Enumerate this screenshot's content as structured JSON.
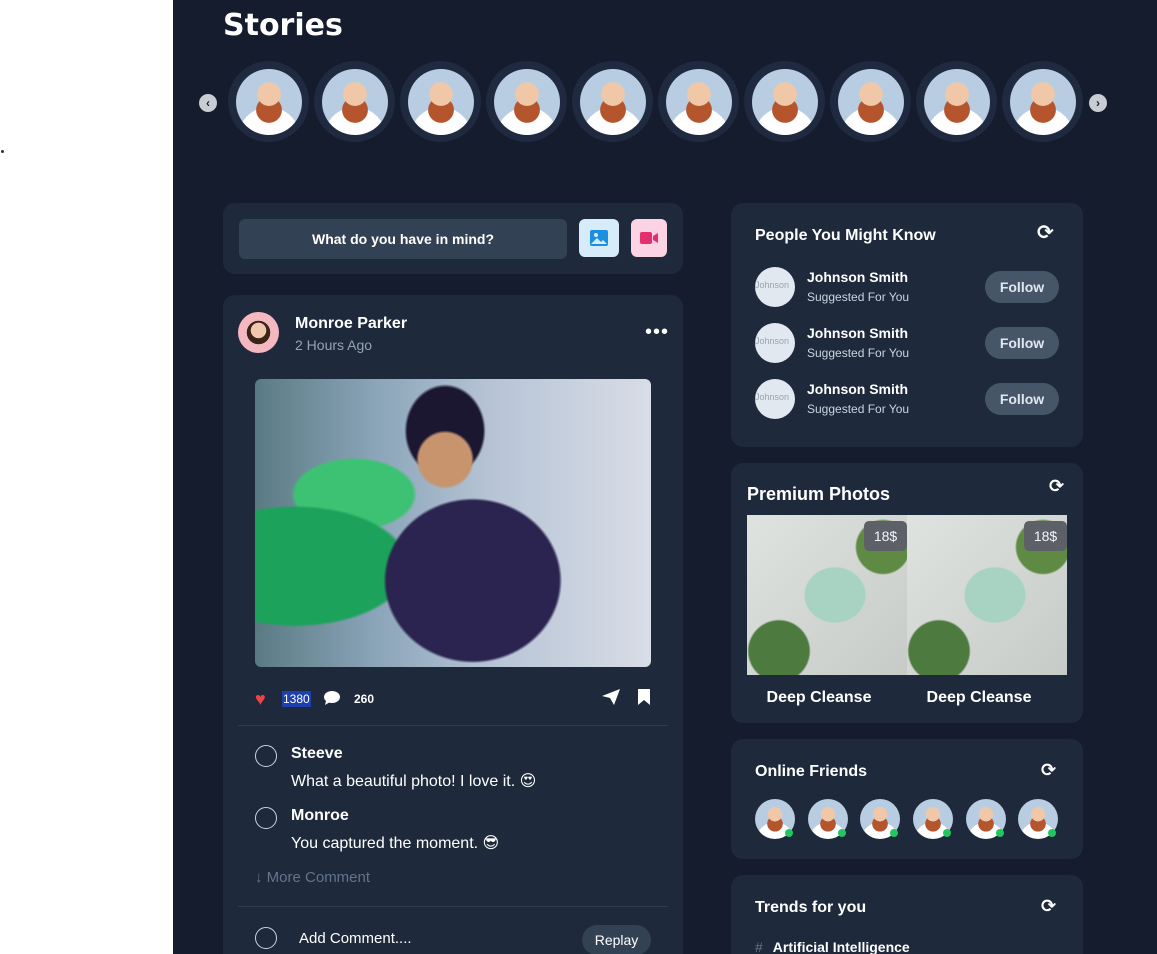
{
  "stories": {
    "title": "Stories",
    "count": 10
  },
  "composer": {
    "placeholder": "What do you have in mind?"
  },
  "post": {
    "author": "Monroe Parker",
    "time": "2 Hours Ago",
    "likes": "1380",
    "comments_count": "260",
    "comments": [
      {
        "name": "Steeve",
        "text": "What a beautiful photo! I love it. 😍"
      },
      {
        "name": "Monroe",
        "text": "You captured the moment. 😎"
      }
    ],
    "more_comment": "More Comment",
    "add_comment": "Add Comment....",
    "replay": "Replay"
  },
  "people": {
    "title": "People You Might Know",
    "items": [
      {
        "alt": "Johnson",
        "name": "Johnson Smith",
        "sub": "Suggested For You",
        "action": "Follow"
      },
      {
        "alt": "Johnson",
        "name": "Johnson Smith",
        "sub": "Suggested For You",
        "action": "Follow"
      },
      {
        "alt": "Johnson",
        "name": "Johnson Smith",
        "sub": "Suggested For You",
        "action": "Follow"
      }
    ]
  },
  "premium": {
    "title": "Premium Photos",
    "items": [
      {
        "price": "18$",
        "label": "Deep Cleanse"
      },
      {
        "price": "18$",
        "label": "Deep Cleanse"
      }
    ]
  },
  "online": {
    "title": "Online Friends",
    "count": 6,
    "status_color": "#22c55e"
  },
  "trends": {
    "title": "Trends for you",
    "items": [
      {
        "hash": "#",
        "label": "Artificial Intelligence"
      }
    ]
  },
  "colors": {
    "background": "#141c2e",
    "card": "#1e293b",
    "like": "#ef4444"
  }
}
